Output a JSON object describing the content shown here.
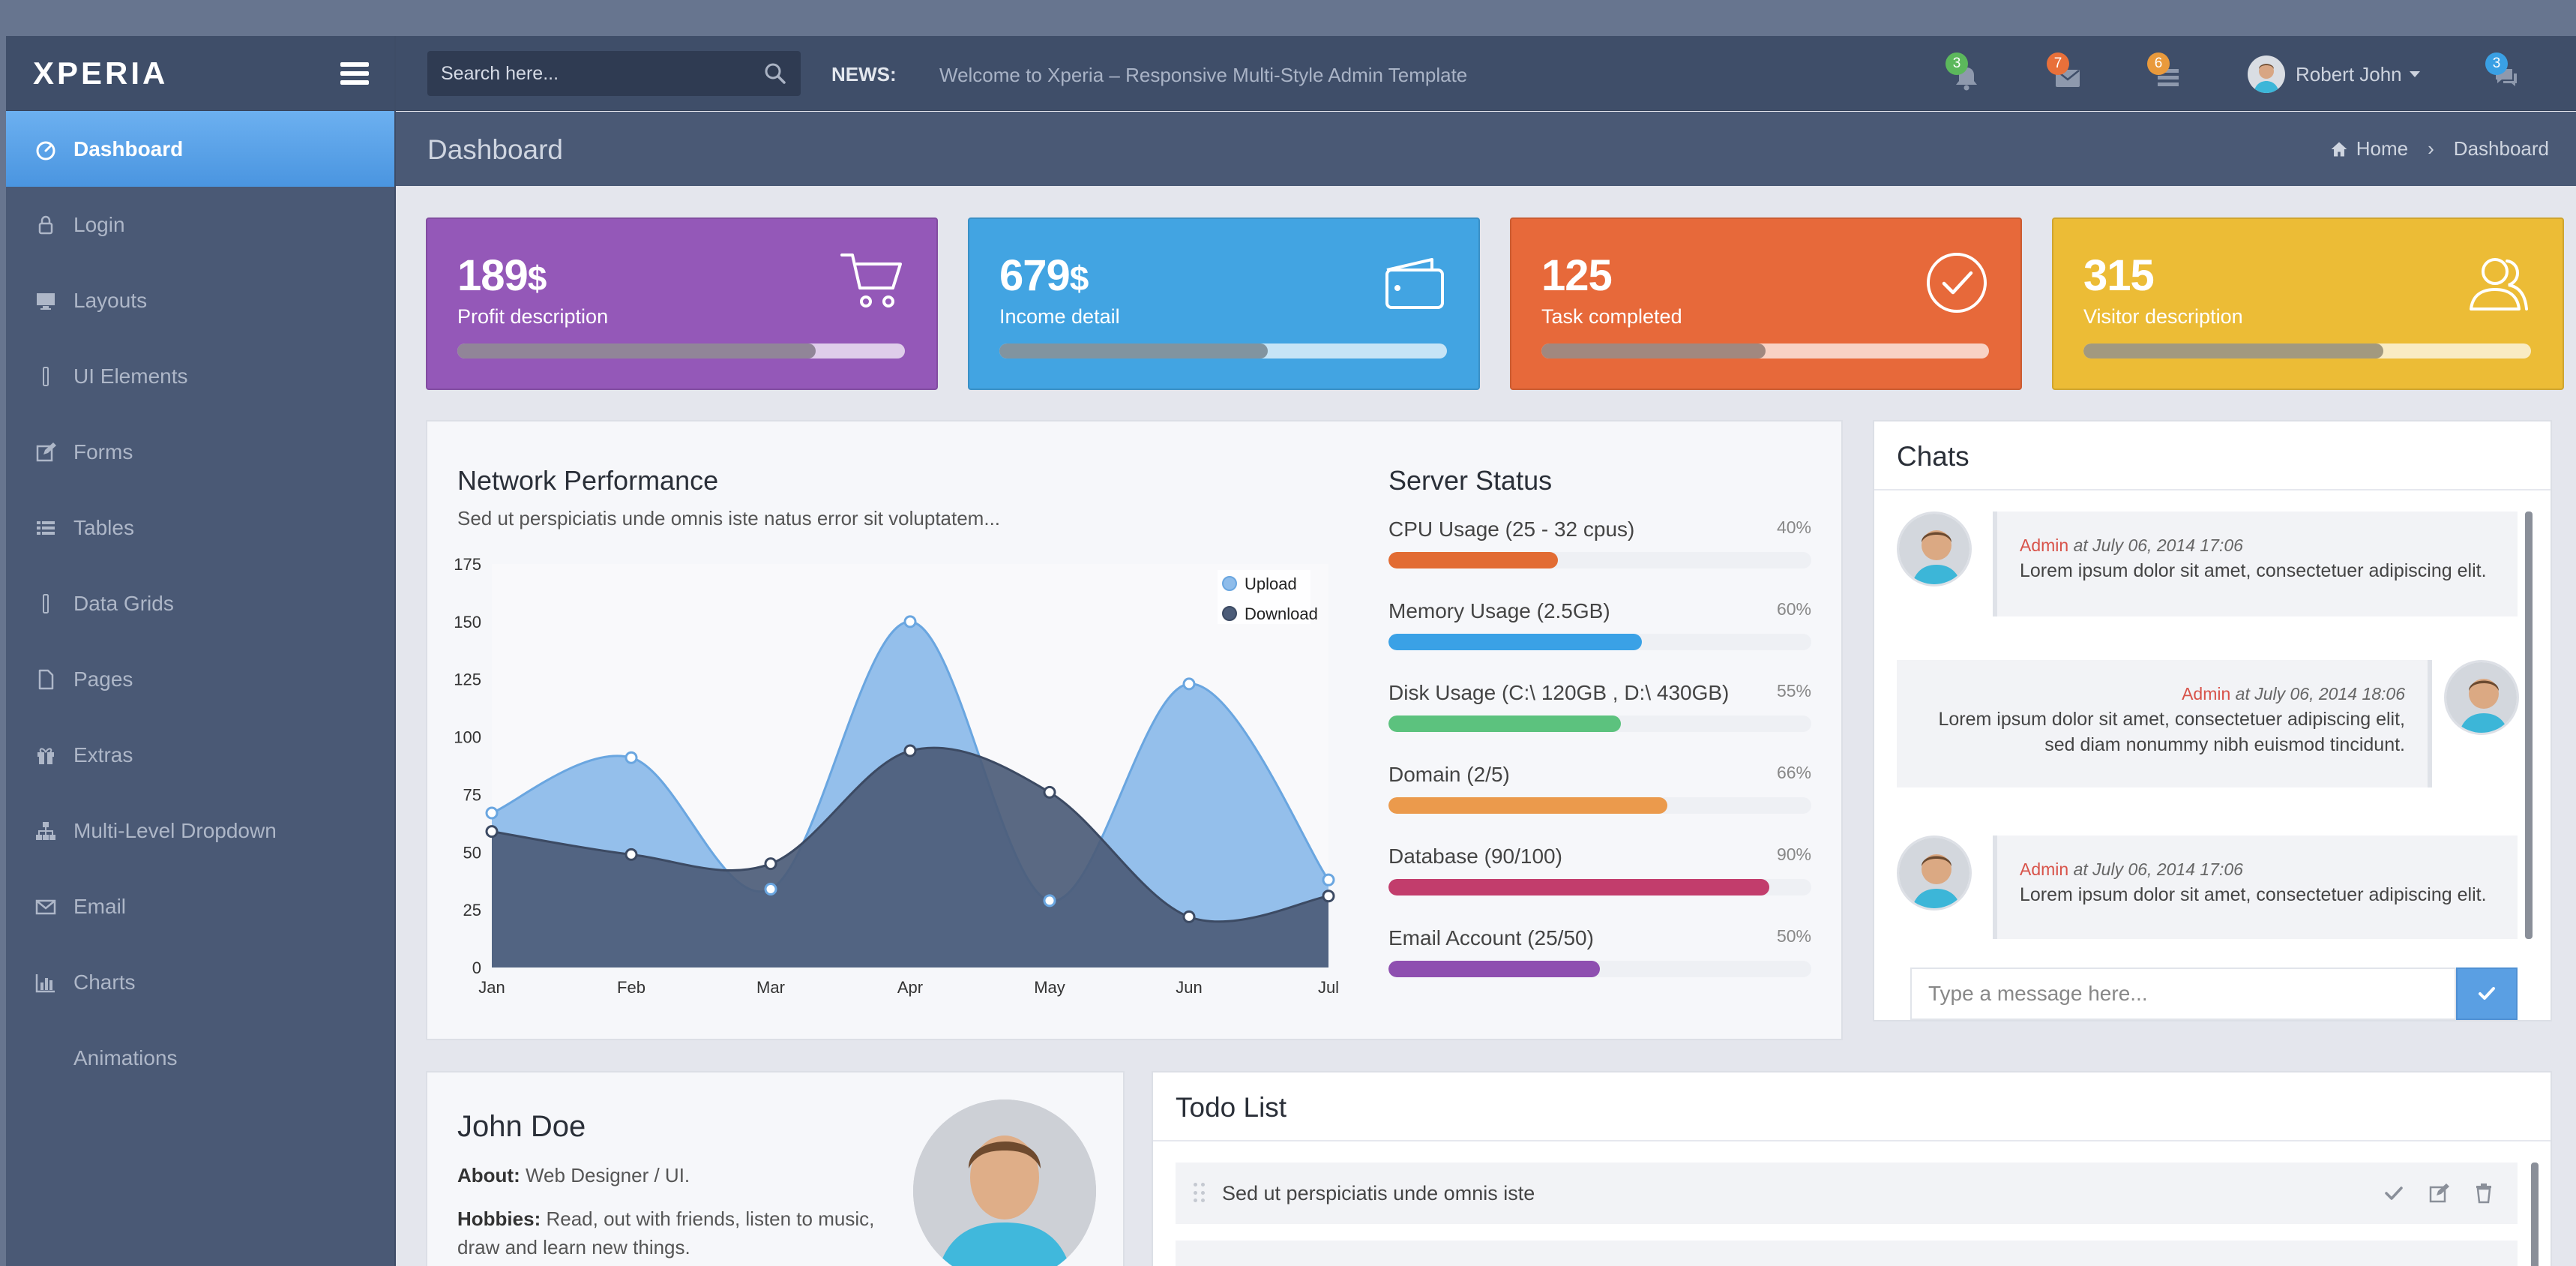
{
  "app": {
    "name": "XPERIA"
  },
  "sidebar": {
    "items": [
      {
        "label": "Dashboard",
        "icon": "dashboard-icon",
        "active": true
      },
      {
        "label": "Login",
        "icon": "lock-icon"
      },
      {
        "label": "Layouts",
        "icon": "monitor-icon"
      },
      {
        "label": "UI Elements",
        "icon": "mobile-icon"
      },
      {
        "label": "Forms",
        "icon": "edit-icon"
      },
      {
        "label": "Tables",
        "icon": "list-icon"
      },
      {
        "label": "Data Grids",
        "icon": "mobile-icon"
      },
      {
        "label": "Pages",
        "icon": "file-icon"
      },
      {
        "label": "Extras",
        "icon": "gift-icon"
      },
      {
        "label": "Multi-Level Dropdown",
        "icon": "sitemap-icon"
      },
      {
        "label": "Email",
        "icon": "envelope-icon"
      },
      {
        "label": "Charts",
        "icon": "bar-chart-icon"
      },
      {
        "label": "Animations",
        "icon": ""
      }
    ]
  },
  "topbar": {
    "search_placeholder": "Search here...",
    "news_label": "NEWS:",
    "news_text": "Welcome to Xperia – Responsive Multi-Style Admin Template",
    "notifications": [
      {
        "icon": "bell-icon",
        "count": "3",
        "color": "#5cb85c"
      },
      {
        "icon": "envelope-icon",
        "count": "7",
        "color": "#e8703a"
      },
      {
        "icon": "tasks-icon",
        "count": "6",
        "color": "#e99a3c"
      },
      {
        "icon": "comments-icon",
        "count": "3",
        "color": "#3aa0e4"
      }
    ],
    "user_name": "Robert John"
  },
  "page": {
    "title": "Dashboard",
    "breadcrumb": [
      "Home",
      "Dashboard"
    ]
  },
  "stats": [
    {
      "value": "189",
      "unit": "$",
      "label": "Profit description",
      "progress": 0.8,
      "color": "#9458b8",
      "icon": "cart-icon"
    },
    {
      "value": "679",
      "unit": "$",
      "label": "Income detail",
      "progress": 0.6,
      "color": "#42a4e2",
      "icon": "wallet-icon"
    },
    {
      "value": "125",
      "unit": "",
      "label": "Task completed",
      "progress": 0.5,
      "color": "#e7693a",
      "icon": "check-circle-icon"
    },
    {
      "value": "315",
      "unit": "",
      "label": "Visitor description",
      "progress": 0.67,
      "color": "#ecbc36",
      "icon": "users-icon"
    }
  ],
  "network": {
    "title": "Network Performance",
    "subtitle": "Sed ut perspiciatis unde omnis iste natus error sit voluptatem..."
  },
  "chart_data": {
    "type": "area",
    "categories": [
      "Jan",
      "Feb",
      "Mar",
      "Apr",
      "May",
      "Jun",
      "Jul"
    ],
    "series": [
      {
        "name": "Upload",
        "values": [
          67,
          91,
          34,
          150,
          29,
          123,
          38
        ],
        "color": "#8ebcea"
      },
      {
        "name": "Download",
        "values": [
          59,
          49,
          45,
          94,
          76,
          22,
          31
        ],
        "color": "#4c5c78"
      }
    ],
    "yticks": [
      0,
      25,
      50,
      75,
      100,
      125,
      150,
      175
    ],
    "ylim": [
      0,
      175
    ],
    "legend": "top-right",
    "grid": false
  },
  "server": {
    "title": "Server Status",
    "items": [
      {
        "label": "CPU Usage (25 - 32 cpus)",
        "pct": "40%",
        "value": 0.4,
        "color": "#e26c33"
      },
      {
        "label": "Memory Usage (2.5GB)",
        "pct": "60%",
        "value": 0.6,
        "color": "#3aa1e6"
      },
      {
        "label": "Disk Usage (C:\\ 120GB , D:\\ 430GB)",
        "pct": "55%",
        "value": 0.55,
        "color": "#5cc27e"
      },
      {
        "label": "Domain (2/5)",
        "pct": "66%",
        "value": 0.66,
        "color": "#eb9a4c"
      },
      {
        "label": "Database (90/100)",
        "pct": "90%",
        "value": 0.9,
        "color": "#c23d6c"
      },
      {
        "label": "Email Account (25/50)",
        "pct": "50%",
        "value": 0.5,
        "color": "#8e4fb0"
      }
    ]
  },
  "chats": {
    "title": "Chats",
    "messages": [
      {
        "author": "Admin",
        "time": "at July 06, 2014 17:06",
        "text": "Lorem ipsum dolor sit amet, consectetuer adipiscing elit.",
        "side": "left"
      },
      {
        "author": "Admin",
        "time": "at July 06, 2014 18:06",
        "text": "Lorem ipsum dolor sit amet, consectetuer adipiscing elit, sed diam nonummy nibh euismod tincidunt.",
        "side": "right"
      },
      {
        "author": "Admin",
        "time": "at July 06, 2014 17:06",
        "text": "Lorem ipsum dolor sit amet, consectetuer adipiscing elit.",
        "side": "left"
      }
    ],
    "input_placeholder": "Type a message here..."
  },
  "profile": {
    "name": "John Doe",
    "about_label": "About:",
    "about": "Web Designer / UI.",
    "hobbies_label": "Hobbies:",
    "hobbies": "Read, out with friends, listen to music, draw and learn new things."
  },
  "todo": {
    "title": "Todo List",
    "items": [
      "Sed ut perspiciatis unde omnis iste"
    ]
  }
}
